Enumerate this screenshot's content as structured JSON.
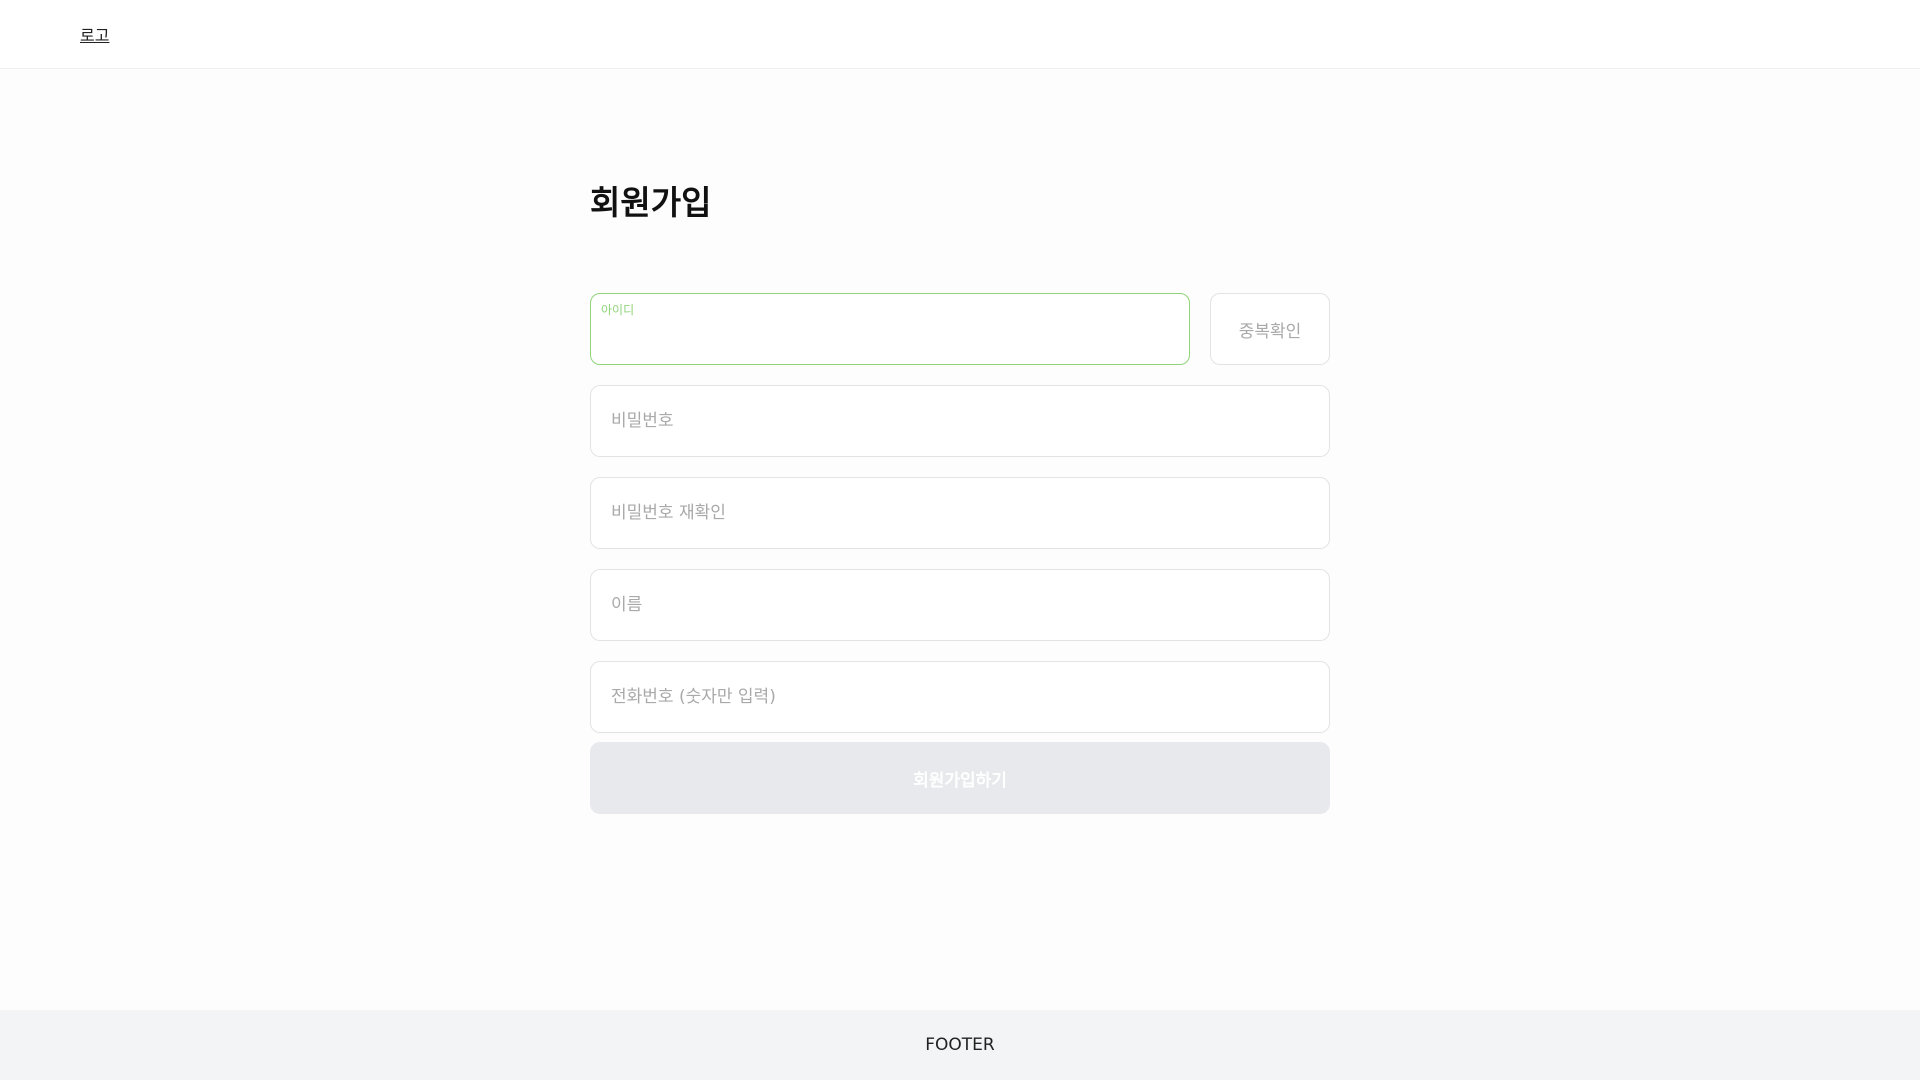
{
  "header": {
    "logo_label": "로고"
  },
  "form": {
    "title": "회원가입",
    "id_field": {
      "label": "아이디",
      "value": ""
    },
    "duplicate_check_label": "중복확인",
    "password_placeholder": "비밀번호",
    "password_confirm_placeholder": "비밀번호 재확인",
    "name_placeholder": "이름",
    "phone_placeholder": "전화번호 (숫자만 입력)",
    "submit_label": "회원가입하기"
  },
  "footer": {
    "text": "FOOTER"
  },
  "colors": {
    "focus_accent": "#8fd47a",
    "disabled_button_bg": "#e8e9ec",
    "footer_bg": "#f3f4f6",
    "placeholder_text": "#a9a9a9"
  }
}
